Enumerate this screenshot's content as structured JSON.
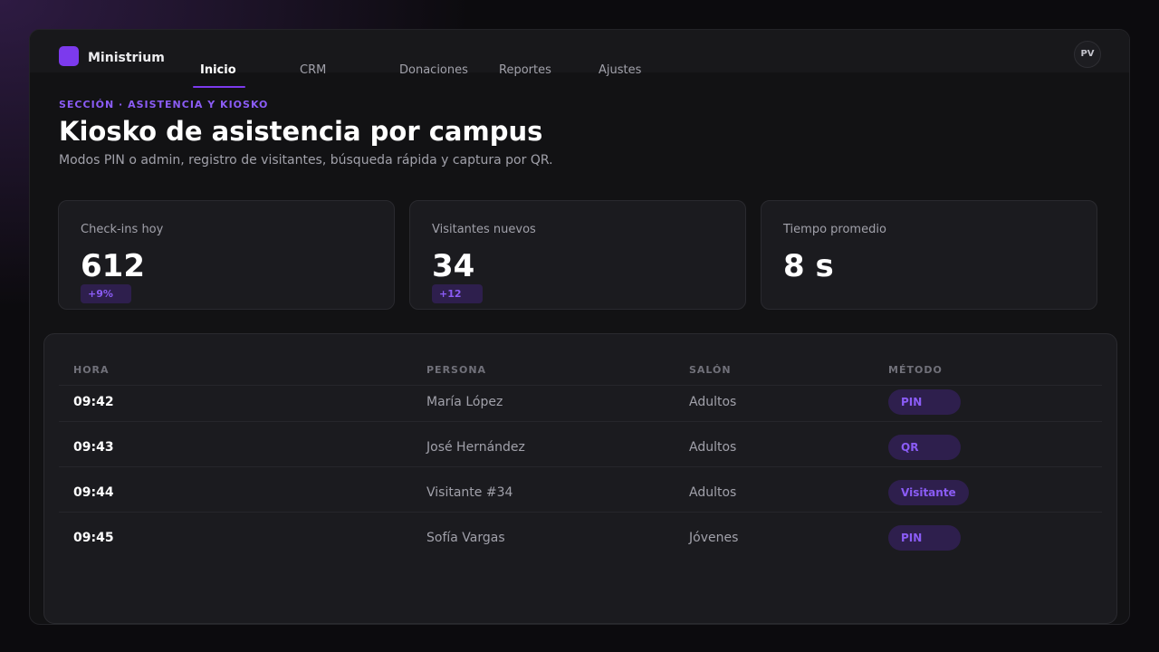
{
  "brand": {
    "name": "Ministrium",
    "accent_color": "#7c3aed"
  },
  "nav": {
    "tabs": [
      {
        "label": "Inicio",
        "active": true
      },
      {
        "label": "CRM",
        "active": false
      },
      {
        "label": "Donaciones",
        "active": false
      },
      {
        "label": "Reportes",
        "active": false
      },
      {
        "label": "Ajustes",
        "active": false
      }
    ]
  },
  "user": {
    "initials": "PV"
  },
  "header": {
    "section_label": "SECCIÓN · ASISTENCIA Y KIOSKO",
    "title": "Kiosko de asistencia por campus",
    "subtitle": "Modos PIN o admin, registro de visitantes, búsqueda rápida y captura por QR."
  },
  "stats": [
    {
      "label": "Check-ins hoy",
      "value": "612",
      "badge": "+9%"
    },
    {
      "label": "Visitantes nuevos",
      "value": "34",
      "badge": "+12"
    },
    {
      "label": "Tiempo promedio",
      "value": "8 s",
      "badge": null
    }
  ],
  "table": {
    "columns": [
      "HORA",
      "PERSONA",
      "SALÓN",
      "MÉTODO"
    ],
    "rows": [
      {
        "hora": "09:42",
        "persona": "María López",
        "salon": "Adultos",
        "metodo": "PIN"
      },
      {
        "hora": "09:43",
        "persona": "José Hernández",
        "salon": "Adultos",
        "metodo": "QR"
      },
      {
        "hora": "09:44",
        "persona": "Visitante #34",
        "salon": "Adultos",
        "metodo": "Visitante"
      },
      {
        "hora": "09:45",
        "persona": "Sofía Vargas",
        "salon": "Jóvenes",
        "metodo": "PIN"
      }
    ]
  }
}
